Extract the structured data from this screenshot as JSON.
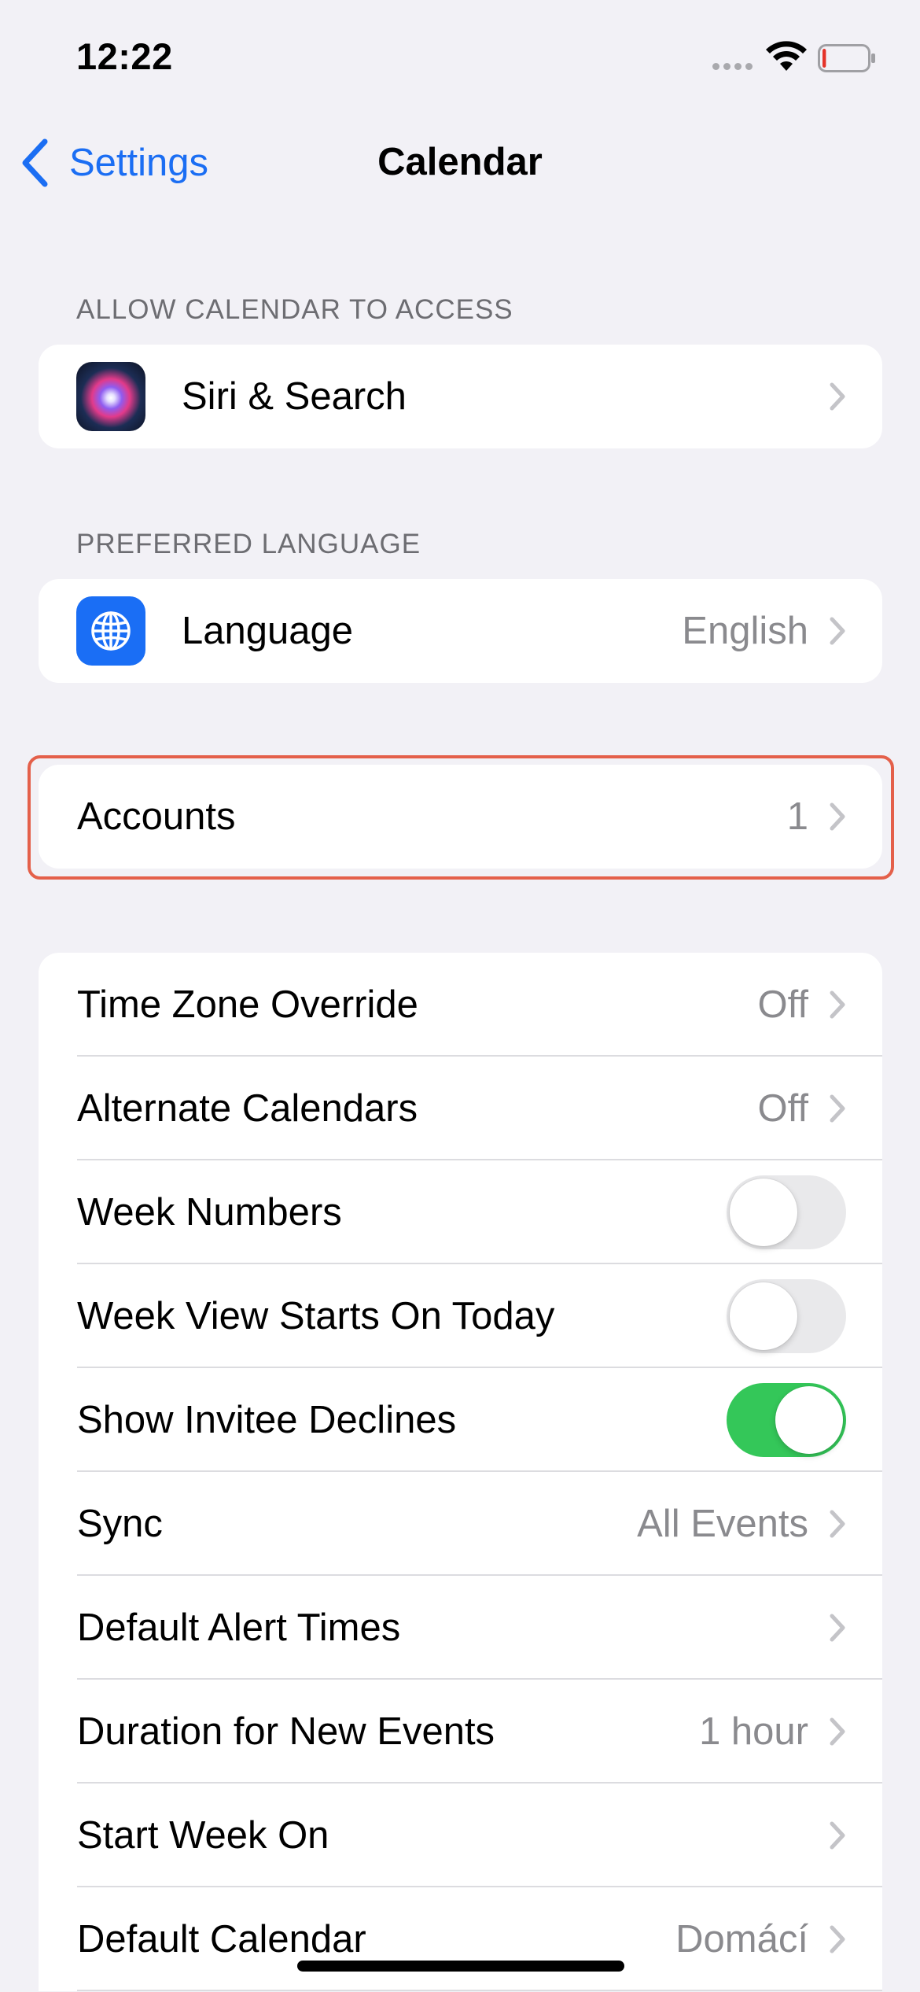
{
  "status_bar": {
    "time": "12:22",
    "icons": [
      "signal-dots",
      "wifi-icon",
      "battery-icon"
    ],
    "battery_level": 0.08,
    "battery_color": "#e5332a"
  },
  "nav": {
    "back_label": "Settings",
    "title": "Calendar",
    "accent_color": "#1b6ef3"
  },
  "sections": {
    "allow_access": {
      "header": "ALLOW CALENDAR TO ACCESS",
      "siri": {
        "label": "Siri & Search",
        "icon": "siri-icon"
      }
    },
    "preferred_language": {
      "header": "PREFERRED LANGUAGE",
      "language": {
        "label": "Language",
        "value": "English",
        "icon": "globe-icon"
      }
    },
    "accounts": {
      "label": "Accounts",
      "value": "1"
    },
    "settings": {
      "time_zone_override": {
        "label": "Time Zone Override",
        "value": "Off"
      },
      "alternate_calendars": {
        "label": "Alternate Calendars",
        "value": "Off"
      },
      "week_numbers": {
        "label": "Week Numbers",
        "on": false
      },
      "week_view_today": {
        "label": "Week View Starts On Today",
        "on": false
      },
      "show_invitee_declines": {
        "label": "Show Invitee Declines",
        "on": true
      },
      "sync": {
        "label": "Sync",
        "value": "All Events"
      },
      "default_alert_times": {
        "label": "Default Alert Times",
        "value": ""
      },
      "duration_new_events": {
        "label": "Duration for New Events",
        "value": "1 hour"
      },
      "start_week_on": {
        "label": "Start Week On",
        "value": ""
      },
      "default_calendar": {
        "label": "Default Calendar",
        "value": "Domácí"
      }
    }
  },
  "colors": {
    "background": "#f2f1f6",
    "toggle_on": "#34c759",
    "highlight": "#e4604a"
  }
}
